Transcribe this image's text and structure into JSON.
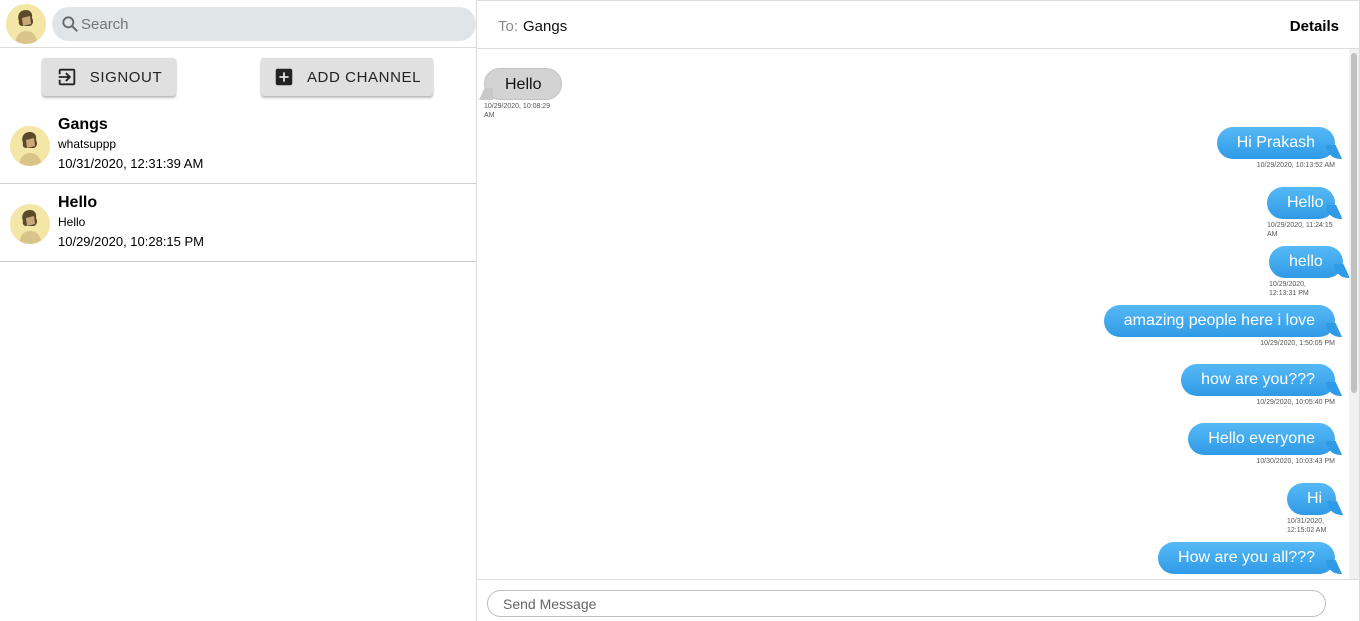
{
  "sidebar": {
    "search": {
      "placeholder": "Search"
    },
    "signout_label": "SIGNOUT",
    "add_channel_label": "ADD CHANNEL",
    "conversations": [
      {
        "name": "Gangs",
        "last_message": "whatsuppp",
        "timestamp": "10/31/2020, 12:31:39 AM"
      },
      {
        "name": "Hello",
        "last_message": "Hello",
        "timestamp": "10/29/2020, 10:28:15 PM"
      }
    ]
  },
  "chat": {
    "to_label": "To:",
    "recipient": "Gangs",
    "details_label": "Details",
    "composer_placeholder": "Send Message",
    "messages": [
      {
        "direction": "incoming",
        "text": "Hello",
        "time": "10/29/2020, 10:08:29 AM"
      },
      {
        "direction": "outgoing",
        "text": "Hi Prakash",
        "time": "10/29/2020, 10:13:52 AM"
      },
      {
        "direction": "outgoing",
        "text": "Hello",
        "time": "10/29/2020, 11:24:15 AM"
      },
      {
        "direction": "outgoing",
        "text": "hello",
        "time": "10/29/2020, 12:13:31 PM"
      },
      {
        "direction": "outgoing",
        "text": "amazing people here i love",
        "time": "10/29/2020, 1:50:05 PM"
      },
      {
        "direction": "outgoing",
        "text": "how are you???",
        "time": "10/29/2020, 10:05:40 PM"
      },
      {
        "direction": "outgoing",
        "text": "Hello everyone",
        "time": "10/30/2020, 10:03:43 PM"
      },
      {
        "direction": "outgoing",
        "text": "Hi",
        "time": "10/31/2020, 12:15:02 AM"
      },
      {
        "direction": "outgoing",
        "text": "How are you all???",
        "time": ""
      }
    ]
  },
  "colors": {
    "outgoing_bubble": "#3aa7ee",
    "incoming_bubble": "#d3d3d3",
    "search_bg": "#e0e5e8",
    "button_bg": "#e0e0e0"
  },
  "icons": {
    "search": "search-icon",
    "signout": "exit-to-app-icon",
    "add_channel": "add-box-icon",
    "avatar": "user-avatar"
  }
}
